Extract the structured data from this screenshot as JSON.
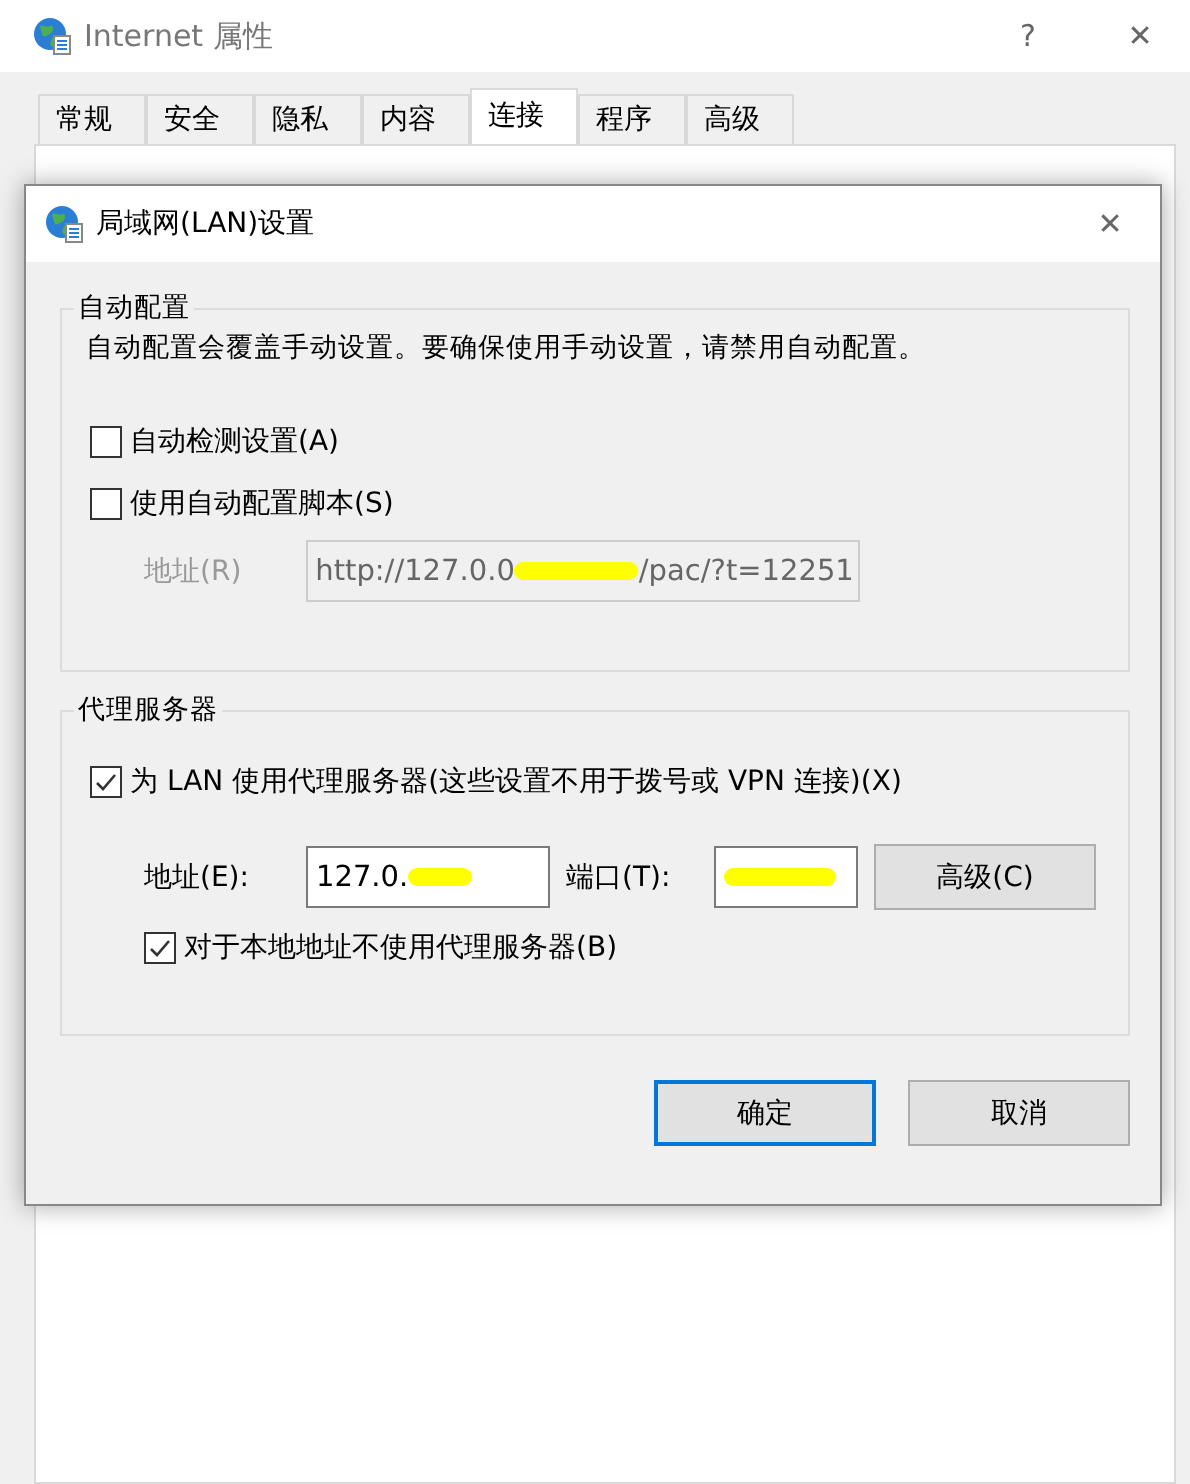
{
  "window": {
    "title": "Internet 属性",
    "help": "?",
    "close": "✕"
  },
  "tabs": [
    {
      "label": "常规",
      "selected": false
    },
    {
      "label": "安全",
      "selected": false
    },
    {
      "label": "隐私",
      "selected": false
    },
    {
      "label": "内容",
      "selected": false
    },
    {
      "label": "连接",
      "selected": true
    },
    {
      "label": "程序",
      "selected": false
    },
    {
      "label": "高级",
      "selected": false
    }
  ],
  "dialog": {
    "title": "局域网(LAN)设置",
    "close": "✕",
    "auto_config": {
      "legend": "自动配置",
      "description": "自动配置会覆盖手动设置。要确保使用手动设置，请禁用自动配置。",
      "options": [
        {
          "label": "自动检测设置(A)",
          "checked": false
        },
        {
          "label": "使用自动配置脚本(S)",
          "checked": false
        }
      ],
      "address": {
        "label": "地址(R)",
        "disabled": true,
        "value_before": "http://127.0.0",
        "redacted": true,
        "value_after": "/pac/?t=12251"
      }
    },
    "proxy": {
      "legend": "代理服务器",
      "use_proxy": {
        "label": "为 LAN 使用代理服务器(这些设置不用于拨号或 VPN 连接)(X)",
        "checked": true
      },
      "address": {
        "label": "地址(E):",
        "value": "127.0.",
        "redacted": true
      },
      "port": {
        "label": "端口(T):",
        "redacted": true
      },
      "advanced": "高级(C)",
      "bypass_local": {
        "label": "对于本地地址不使用代理服务器(B)",
        "checked": true
      }
    },
    "buttons": [
      {
        "label": "确定",
        "default": true
      },
      {
        "label": "取消",
        "default": false
      }
    ]
  }
}
